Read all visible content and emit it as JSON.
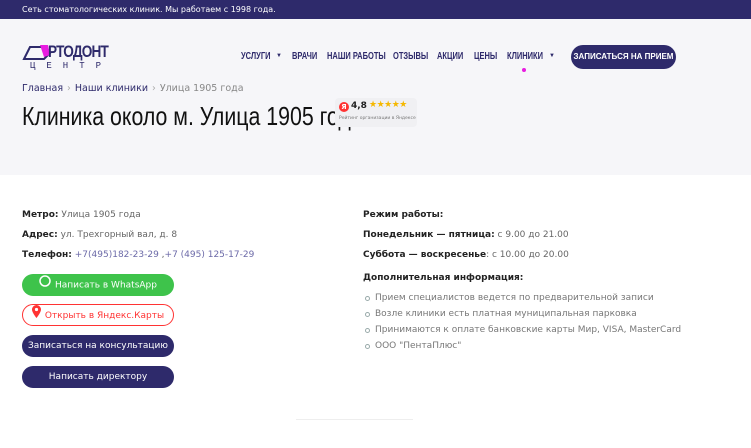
{
  "topbar": {
    "text": "Сеть стоматологических клиник. Мы работаем с 1998 года."
  },
  "logo": {
    "line1": "РТОДОНТ",
    "line2": "ЦЕНТР"
  },
  "nav": {
    "items": [
      {
        "label": "УСЛУГИ",
        "dropdown": true
      },
      {
        "label": "ВРАЧИ"
      },
      {
        "label": "НАШИ РАБОТЫ"
      },
      {
        "label": "ОТЗЫВЫ"
      },
      {
        "label": "АКЦИИ"
      },
      {
        "label": "ЦЕНЫ"
      },
      {
        "label": "КЛИНИКИ",
        "dropdown": true,
        "active": true
      }
    ],
    "cta": "ЗАПИСАТЬСЯ НА ПРИЕМ"
  },
  "breadcrumb": [
    "Главная",
    "Наши клиники",
    "Улица 1905 года"
  ],
  "title": "Клиника около м. Улица 1905 года",
  "rating": {
    "badge": "Я",
    "value": "4,8",
    "stars": "★★★★★",
    "caption": "Рейтинг организации в Яндексе"
  },
  "contacts": {
    "metro_label": "Метро:",
    "metro": "Улица 1905 года",
    "address_label": "Адрес:",
    "address": "ул. Трехгорный вал, д. 8",
    "phone_label": "Телефон:",
    "phone1": "+7(495)182-23-29",
    "phone_sep": " ,",
    "phone2": "+7 (495) 125-17-29"
  },
  "buttons": {
    "whatsapp": "Написать в WhatsApp",
    "yandex": "Открыть в Яндекс.Карты",
    "consult": "Записаться на консультацию",
    "director": "Написать директору"
  },
  "schedule": {
    "heading": "Режим работы:",
    "weekdays_label": "Понедельник — пятница:",
    "weekdays": " с 9.00 до 21.00",
    "weekend_label": "Суббота — воскресенье",
    "weekend": ": с 10.00 до 20.00"
  },
  "extra": {
    "heading": "Дополнительная информация:",
    "items": [
      "Прием специалистов ведется по предварительной записи",
      "Возле клиники есть платная муниципальная парковка",
      "Принимаются к оплате банковские карты Мир, VISA, MasterCard",
      "ООО \"ПентаПлюс\""
    ]
  },
  "colors": {
    "brand": "#2e2a6b",
    "accent": "#e81ce0",
    "whatsapp": "#3ec34b",
    "yandex": "#ff3333"
  }
}
